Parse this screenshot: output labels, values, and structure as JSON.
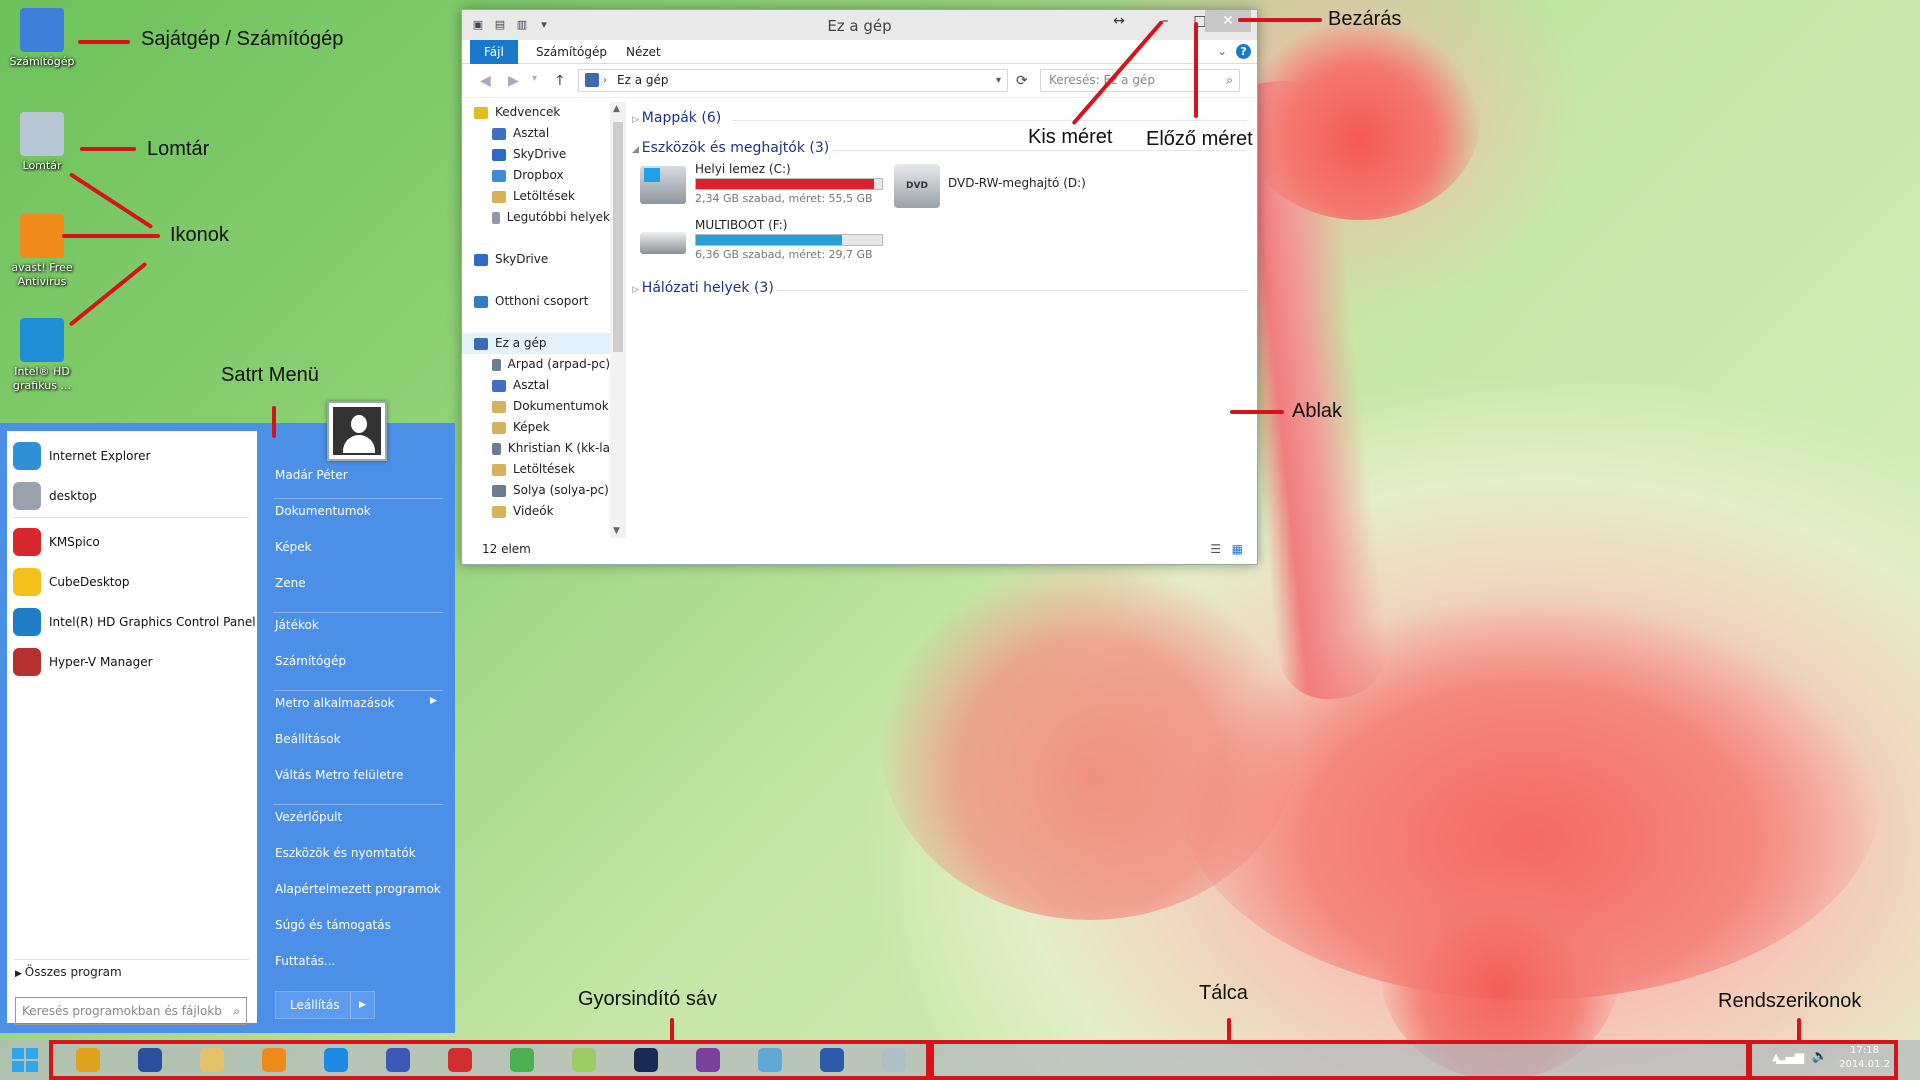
{
  "desktop_icons": [
    {
      "label": "Számítógép",
      "color": "#3d7fd9"
    },
    {
      "label": "Lomtár",
      "color": "#b9c6d6"
    },
    {
      "label": "avast! Free Antivirus",
      "color": "#f08a1a"
    },
    {
      "label": "Intel® HD grafikus ...",
      "color": "#1f8fd6"
    }
  ],
  "annotations": {
    "computer": "Sajátgép / Számítógép",
    "recycle": "Lomtár",
    "icons": "Ikonok",
    "start_menu": "Satrt Menü",
    "minimize": "Kis méret",
    "restore": "Előző méret",
    "close": "Bezárás",
    "window": "Ablak",
    "quicklaunch": "Gyorsindító sáv",
    "taskbar": "Tálca",
    "tray": "Rendszerikonok"
  },
  "explorer": {
    "title": "Ez a gép",
    "tabs": [
      "Fájl",
      "Számítógép",
      "Nézet"
    ],
    "address": "Ez a gép",
    "search_placeholder": "Keresés: Ez a gép",
    "nav": [
      {
        "label": "Kedvencek",
        "indent": 0,
        "color": "#e8b923"
      },
      {
        "label": "Asztal",
        "indent": 1,
        "color": "#3e6fc4"
      },
      {
        "label": "SkyDrive",
        "indent": 1,
        "color": "#2d6bc9"
      },
      {
        "label": "Dropbox",
        "indent": 1,
        "color": "#3f8ad8"
      },
      {
        "label": "Letöltések",
        "indent": 1,
        "color": "#d8b25a"
      },
      {
        "label": "Legutóbbi helyek",
        "indent": 1,
        "color": "#8d9aa8"
      },
      {
        "label": "",
        "indent": 0,
        "color": ""
      },
      {
        "label": "SkyDrive",
        "indent": 0,
        "color": "#2d6bc9"
      },
      {
        "label": "",
        "indent": 0,
        "color": ""
      },
      {
        "label": "Otthoni csoport",
        "indent": 0,
        "color": "#2e7fc2"
      },
      {
        "label": "",
        "indent": 0,
        "color": ""
      },
      {
        "label": "Ez a gép",
        "indent": 0,
        "color": "#3b69b3"
      },
      {
        "label": "Arpad (arpad-pc)",
        "indent": 1,
        "color": "#6a7d93"
      },
      {
        "label": "Asztal",
        "indent": 1,
        "color": "#3e6fc4"
      },
      {
        "label": "Dokumentumok",
        "indent": 1,
        "color": "#d8b25a"
      },
      {
        "label": "Képek",
        "indent": 1,
        "color": "#d8b25a"
      },
      {
        "label": "Khristian K (kk-la",
        "indent": 1,
        "color": "#6a7d93"
      },
      {
        "label": "Letöltések",
        "indent": 1,
        "color": "#d8b25a"
      },
      {
        "label": "Solya (solya-pc)",
        "indent": 1,
        "color": "#6a7d93"
      },
      {
        "label": "Videók",
        "indent": 1,
        "color": "#d8b25a"
      }
    ],
    "groups": {
      "folders": "Mappák (6)",
      "devices": "Eszközök és meghajtók (3)",
      "network": "Hálózati helyek (3)"
    },
    "drives": [
      {
        "name": "Helyi lemez (C:)",
        "info": "2,34 GB szabad, méret: 55,5 GB",
        "used_fraction": 0.958,
        "bar_color": "#e0202a"
      },
      {
        "name": "MULTIBOOT (F:)",
        "info": "6,36 GB szabad, méret: 29,7 GB",
        "used_fraction": 0.786,
        "bar_color": "#26a0da"
      }
    ],
    "dvd": {
      "name": "DVD-RW-meghajtó (D:)",
      "icon_text": "DVD"
    },
    "status": "12 elem"
  },
  "start_menu": {
    "programs": [
      {
        "label": "Internet Explorer",
        "color": "#2f8fd8"
      },
      {
        "label": "desktop",
        "color": "#9aa3ad"
      },
      {
        "label": "KMSpico",
        "color": "#d8282e"
      },
      {
        "label": "CubeDesktop",
        "color": "#f2c21a"
      },
      {
        "label": "Intel(R) HD Graphics Control Panel",
        "color": "#1f7fc6"
      },
      {
        "label": "Hyper-V Manager",
        "color": "#b73030"
      }
    ],
    "all_programs": "Összes program",
    "search_placeholder": "Keresés programokban és fájlokban",
    "right": [
      "Madár Péter",
      "Dokumentumok",
      "Képek",
      "Zene",
      "Játékok",
      "Számítógép",
      "Metro alkalmazások",
      "Beállítások",
      "Váltás Metro felületre",
      "Vezérlőpult",
      "Eszközök és nyomtatók",
      "Alapértelmezett programok",
      "Súgó és támogatás",
      "Futtatás..."
    ],
    "shutdown": "Leállítás"
  },
  "taskbar": {
    "apps": [
      {
        "name": "chrome-icon",
        "color": "#e0a21a"
      },
      {
        "name": "floppy-icon",
        "color": "#2b4f9c"
      },
      {
        "name": "folder-icon",
        "color": "#e3c16b"
      },
      {
        "name": "vlc-icon",
        "color": "#f08a1a"
      },
      {
        "name": "teamviewer-icon",
        "color": "#1e88e5"
      },
      {
        "name": "infinity-icon",
        "color": "#3b5ab7"
      },
      {
        "name": "pdf-icon",
        "color": "#d32f2f"
      },
      {
        "name": "utorrent-icon",
        "color": "#4caf50"
      },
      {
        "name": "paint-icon",
        "color": "#9ccc65"
      },
      {
        "name": "photoshop-icon",
        "color": "#1b2a55"
      },
      {
        "name": "winrar-icon",
        "color": "#7b3f9e"
      },
      {
        "name": "map-icon",
        "color": "#5fa9d6"
      },
      {
        "name": "word-icon",
        "color": "#2a5aa8"
      },
      {
        "name": "disc-icon",
        "color": "#b0bec5"
      }
    ],
    "clock_time": "17:18",
    "clock_date": "2014.01.2"
  }
}
